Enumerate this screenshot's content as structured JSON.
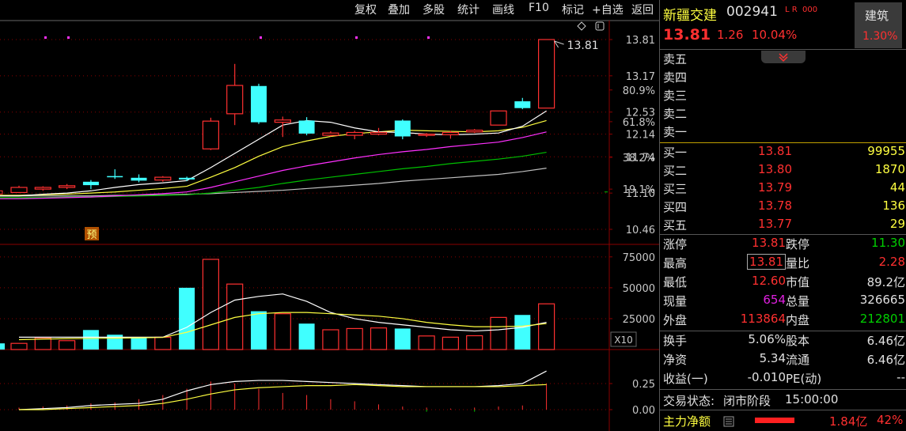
{
  "toolbar": {
    "items": [
      "复权",
      "叠加",
      "多股",
      "统计",
      "画线",
      "F10",
      "标记",
      "+自选",
      "返回"
    ]
  },
  "chart": {
    "price_ticks": [
      "13.81",
      "13.17",
      "12.53",
      "12.14",
      "11.74",
      "11.10",
      "10.46"
    ],
    "pct_ticks": [
      "80.9%",
      "61.8%",
      "38.2%",
      "19.1%"
    ],
    "vol_ticks": [
      "75000",
      "50000",
      "25000"
    ],
    "vol_multiplier": "X10",
    "ind_ticks": [
      "0.25",
      "0.00"
    ],
    "price_label": "13.81",
    "forecast_badge": "预",
    "candles": [
      {
        "o": 11.11,
        "c": 11.2,
        "h": 11.23,
        "l": 11.1,
        "t": "up"
      },
      {
        "o": 11.17,
        "c": 11.2,
        "h": 11.22,
        "l": 11.14,
        "t": "up"
      },
      {
        "o": 11.2,
        "c": 11.23,
        "h": 11.26,
        "l": 11.17,
        "t": "up"
      },
      {
        "o": 11.3,
        "c": 11.24,
        "h": 11.33,
        "l": 11.17,
        "t": "down"
      },
      {
        "o": 11.4,
        "c": 11.4,
        "h": 11.52,
        "l": 11.35,
        "t": "down"
      },
      {
        "o": 11.37,
        "c": 11.32,
        "h": 11.43,
        "l": 11.29,
        "t": "down"
      },
      {
        "o": 11.33,
        "c": 11.38,
        "h": 11.4,
        "l": 11.3,
        "t": "up"
      },
      {
        "o": 11.37,
        "c": 11.34,
        "h": 11.39,
        "l": 11.31,
        "t": "down"
      },
      {
        "o": 11.88,
        "c": 12.37,
        "h": 12.43,
        "l": 11.86,
        "t": "up"
      },
      {
        "o": 12.5,
        "c": 13.0,
        "h": 13.38,
        "l": 12.3,
        "t": "up"
      },
      {
        "o": 12.99,
        "c": 12.35,
        "h": 13.03,
        "l": 12.32,
        "t": "down"
      },
      {
        "o": 12.35,
        "c": 12.39,
        "h": 12.45,
        "l": 12.09,
        "t": "up"
      },
      {
        "o": 12.38,
        "c": 12.15,
        "h": 12.44,
        "l": 12.12,
        "t": "down"
      },
      {
        "o": 12.12,
        "c": 12.16,
        "h": 12.19,
        "l": 12.1,
        "t": "up"
      },
      {
        "o": 12.12,
        "c": 12.17,
        "h": 12.2,
        "l": 12.05,
        "t": "up"
      },
      {
        "o": 12.14,
        "c": 12.17,
        "h": 12.25,
        "l": 12.12,
        "t": "up"
      },
      {
        "o": 12.38,
        "c": 12.1,
        "h": 12.4,
        "l": 12.05,
        "t": "down"
      },
      {
        "o": 12.12,
        "c": 12.14,
        "h": 12.16,
        "l": 12.09,
        "t": "up"
      },
      {
        "o": 12.13,
        "c": 12.17,
        "h": 12.2,
        "l": 12.06,
        "t": "up"
      },
      {
        "o": 12.18,
        "c": 12.21,
        "h": 12.23,
        "l": 12.16,
        "t": "up"
      },
      {
        "o": 12.3,
        "c": 12.55,
        "h": 12.55,
        "l": 12.3,
        "t": "up"
      },
      {
        "o": 12.72,
        "c": 12.6,
        "h": 12.78,
        "l": 12.58,
        "t": "down"
      },
      {
        "o": 12.6,
        "c": 13.81,
        "h": 13.81,
        "l": 12.6,
        "t": "up"
      }
    ],
    "ma_white": [
      11.05,
      11.08,
      11.1,
      11.14,
      11.2,
      11.25,
      11.28,
      11.32,
      11.55,
      11.8,
      12.05,
      12.3,
      12.38,
      12.35,
      12.25,
      12.18,
      12.17,
      12.14,
      12.13,
      12.14,
      12.16,
      12.28,
      12.55
    ],
    "ma_yellow": [
      11.06,
      11.07,
      11.08,
      11.1,
      11.12,
      11.15,
      11.18,
      11.22,
      11.38,
      11.55,
      11.75,
      11.92,
      12.02,
      12.1,
      12.15,
      12.18,
      12.21,
      12.2,
      12.19,
      12.18,
      12.2,
      12.26,
      12.38
    ],
    "ma_magenta": [
      11.0,
      11.01,
      11.02,
      11.03,
      11.05,
      11.07,
      11.09,
      11.12,
      11.2,
      11.3,
      11.4,
      11.5,
      11.58,
      11.65,
      11.72,
      11.78,
      11.83,
      11.87,
      11.92,
      11.96,
      12.0,
      12.08,
      12.18
    ],
    "ma_green": [
      11.02,
      11.02,
      11.03,
      11.03,
      11.04,
      11.05,
      11.06,
      11.07,
      11.1,
      11.15,
      11.2,
      11.27,
      11.33,
      11.38,
      11.43,
      11.48,
      11.53,
      11.57,
      11.62,
      11.66,
      11.7,
      11.75,
      11.82
    ],
    "ma_gray": [
      11.05,
      11.05,
      11.05,
      11.05,
      11.06,
      11.06,
      11.07,
      11.08,
      11.09,
      11.11,
      11.13,
      11.15,
      11.18,
      11.21,
      11.24,
      11.27,
      11.31,
      11.34,
      11.37,
      11.4,
      11.43,
      11.48,
      11.54
    ],
    "volume": [
      5000,
      9500,
      7200,
      15800,
      12000,
      9500,
      10000,
      50000,
      73000,
      53000,
      31000,
      29000,
      21000,
      16000,
      17000,
      17500,
      17000,
      11000,
      10000,
      11200,
      26000,
      28000,
      37000
    ],
    "vol_ma_white": [
      10000,
      10000,
      10000,
      10000,
      10000,
      10000,
      10000,
      18000,
      30000,
      40000,
      43000,
      45000,
      39000,
      30000,
      25000,
      22000,
      20000,
      18000,
      16000,
      15000,
      16000,
      18000,
      22000
    ],
    "vol_ma_yellow": [
      8000,
      8500,
      8800,
      9000,
      9200,
      9500,
      9800,
      14000,
      20000,
      26000,
      29000,
      30000,
      30000,
      29000,
      28000,
      27000,
      25000,
      22000,
      20000,
      18500,
      18500,
      19000,
      21000
    ],
    "ind_white": [
      0.0,
      0.01,
      0.02,
      0.04,
      0.05,
      0.06,
      0.1,
      0.18,
      0.24,
      0.27,
      0.28,
      0.28,
      0.27,
      0.26,
      0.25,
      0.24,
      0.23,
      0.22,
      0.22,
      0.22,
      0.23,
      0.25,
      0.37
    ],
    "ind_yellow": [
      0.0,
      0.0,
      0.01,
      0.02,
      0.03,
      0.04,
      0.06,
      0.1,
      0.15,
      0.19,
      0.21,
      0.22,
      0.23,
      0.23,
      0.24,
      0.23,
      0.22,
      0.22,
      0.22,
      0.22,
      0.22,
      0.23,
      0.24
    ],
    "ind_bars": [
      0.02,
      0.03,
      0.04,
      0.06,
      0.07,
      0.1,
      0.14,
      0.2,
      0.27,
      0.25,
      0.2,
      0.16,
      0.14,
      0.1,
      0.08,
      0.05,
      0.03,
      0.02,
      0.01,
      0.02,
      0.03,
      0.04,
      0.25
    ],
    "ind_bars_neg": [
      0,
      0,
      0,
      0,
      0,
      0,
      0,
      0,
      0,
      0,
      0,
      0,
      0,
      0,
      0,
      0,
      0,
      0.02,
      0,
      0.02,
      0,
      0,
      0
    ]
  },
  "stock": {
    "name": "新疆交建",
    "code": "002941",
    "flags": "L R",
    "level": "000",
    "price": "13.81",
    "change": "1.26",
    "change_pct": "10.04%",
    "sector": "建筑",
    "sector_pct": "1.30%"
  },
  "sell": [
    {
      "label": "卖五",
      "price": "",
      "vol": ""
    },
    {
      "label": "卖四",
      "price": "",
      "vol": ""
    },
    {
      "label": "卖三",
      "price": "",
      "vol": ""
    },
    {
      "label": "卖二",
      "price": "",
      "vol": ""
    },
    {
      "label": "卖一",
      "price": "",
      "vol": ""
    }
  ],
  "buy": [
    {
      "label": "买一",
      "price": "13.81",
      "vol": "99955"
    },
    {
      "label": "买二",
      "price": "13.80",
      "vol": "1870"
    },
    {
      "label": "买三",
      "price": "13.79",
      "vol": "44"
    },
    {
      "label": "买四",
      "price": "13.78",
      "vol": "136"
    },
    {
      "label": "买五",
      "price": "13.77",
      "vol": "29"
    }
  ],
  "stats": [
    {
      "l1": "涨停",
      "v1": "13.81",
      "c1": "#ff3030",
      "l2": "跌停",
      "v2": "11.30",
      "c2": "#00d000"
    },
    {
      "l1": "最高",
      "v1": "13.81",
      "c1": "#ff3030",
      "l2": "量比",
      "v2": "2.28",
      "c2": "#ff3030"
    },
    {
      "l1": "最低",
      "v1": "12.60",
      "c1": "#ff3030",
      "l2": "市值",
      "v2": "89.2亿",
      "c2": "#e0e0e0"
    },
    {
      "l1": "现量",
      "v1": "654",
      "c1": "#e020e0",
      "l2": "总量",
      "v2": "326665",
      "c2": "#e0e0e0"
    },
    {
      "l1": "外盘",
      "v1": "113864",
      "c1": "#ff3030",
      "l2": "内盘",
      "v2": "212801",
      "c2": "#00d000"
    }
  ],
  "stats2": [
    {
      "l1": "换手",
      "v1": "5.06%",
      "c1": "#e0e0e0",
      "l2": "股本",
      "v2": "6.46亿",
      "c2": "#e0e0e0"
    },
    {
      "l1": "净资",
      "v1": "5.34",
      "c1": "#e0e0e0",
      "l2": "流通",
      "v2": "6.46亿",
      "c2": "#e0e0e0"
    },
    {
      "l1": "收益(一)",
      "v1": "-0.010",
      "c1": "#e0e0e0",
      "l2": "PE(动)",
      "v2": "--",
      "c2": "#e0e0e0"
    }
  ],
  "status": {
    "label": "交易状态:",
    "value": "闭市阶段",
    "time": "15:00:00"
  },
  "flow": {
    "label": "主力净额",
    "amount": "1.84亿",
    "pct": "42%",
    "fill": 0.42
  },
  "colors": {
    "up": "#ff3030",
    "down": "#40ffff",
    "ma_white": "#ffffff",
    "ma_yellow": "#ffff40",
    "ma_magenta": "#ff30ff",
    "ma_green": "#00c000",
    "ma_gray": "#c0c0c0",
    "grid": "#8a0000"
  }
}
